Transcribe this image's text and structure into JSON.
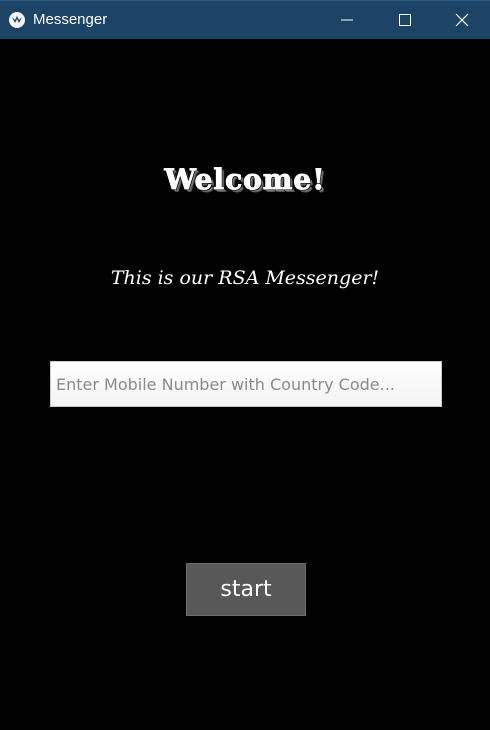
{
  "window": {
    "title": "Messenger",
    "titlebar_color": "#1c4466",
    "icon": "kivy-logo-icon",
    "controls": {
      "minimize_icon": "minimize-icon",
      "maximize_icon": "maximize-icon",
      "close_icon": "close-icon"
    }
  },
  "main": {
    "heading": "Welcome!",
    "subtitle": "This is our RSA Messenger!",
    "phone_input": {
      "placeholder": "Enter Mobile Number with Country Code...",
      "value": ""
    },
    "start_button_label": "start",
    "background_color": "#000000",
    "button_color": "#585858"
  }
}
